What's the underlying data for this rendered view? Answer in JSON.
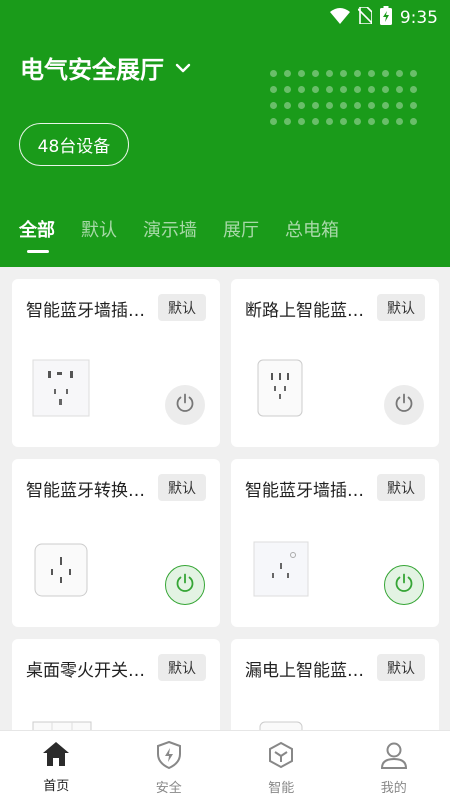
{
  "status": {
    "time": "9:35"
  },
  "header": {
    "title": "电气安全展厅",
    "device_count": "48台设备"
  },
  "tabs": [
    {
      "label": "全部"
    },
    {
      "label": "默认"
    },
    {
      "label": "演示墙"
    },
    {
      "label": "展厅"
    },
    {
      "label": "总电箱"
    }
  ],
  "devices": [
    {
      "name": "智能蓝牙墙插…",
      "badge": "默认",
      "power": "off"
    },
    {
      "name": "断路上智能蓝…",
      "badge": "默认",
      "power": "off"
    },
    {
      "name": "智能蓝牙转换…",
      "badge": "默认",
      "power": "on"
    },
    {
      "name": "智能蓝牙墙插…",
      "badge": "默认",
      "power": "on"
    },
    {
      "name": "桌面零火开关…",
      "badge": "默认",
      "power": "off"
    },
    {
      "name": "漏电上智能蓝…",
      "badge": "默认",
      "power": "off"
    }
  ],
  "nav": [
    {
      "label": "首页",
      "icon": "home-icon"
    },
    {
      "label": "安全",
      "icon": "shield-icon"
    },
    {
      "label": "智能",
      "icon": "cube-icon"
    },
    {
      "label": "我的",
      "icon": "user-icon"
    }
  ],
  "colors": {
    "brand": "#1a9b1a",
    "power_on": "#35a535"
  }
}
